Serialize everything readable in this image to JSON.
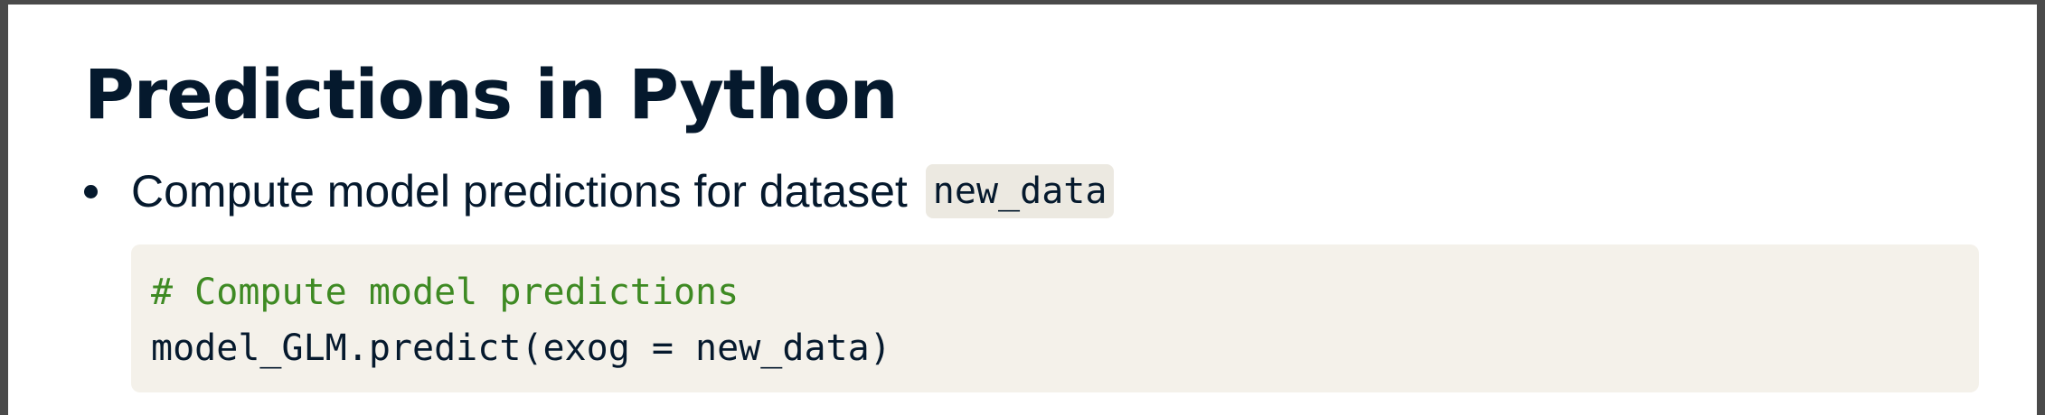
{
  "slide": {
    "title": "Predictions in Python",
    "bullet": {
      "text": "Compute model predictions for dataset",
      "inline_code": "new_data"
    },
    "code": {
      "comment": "# Compute model predictions",
      "line": "model_GLM.predict(exog = new_data)"
    }
  },
  "colors": {
    "title": "#05192d",
    "comment": "#3e8a23",
    "code_background": "#f4f1ea",
    "inline_code_background": "#ece9e1",
    "frame_border": "#4a4a4a"
  }
}
